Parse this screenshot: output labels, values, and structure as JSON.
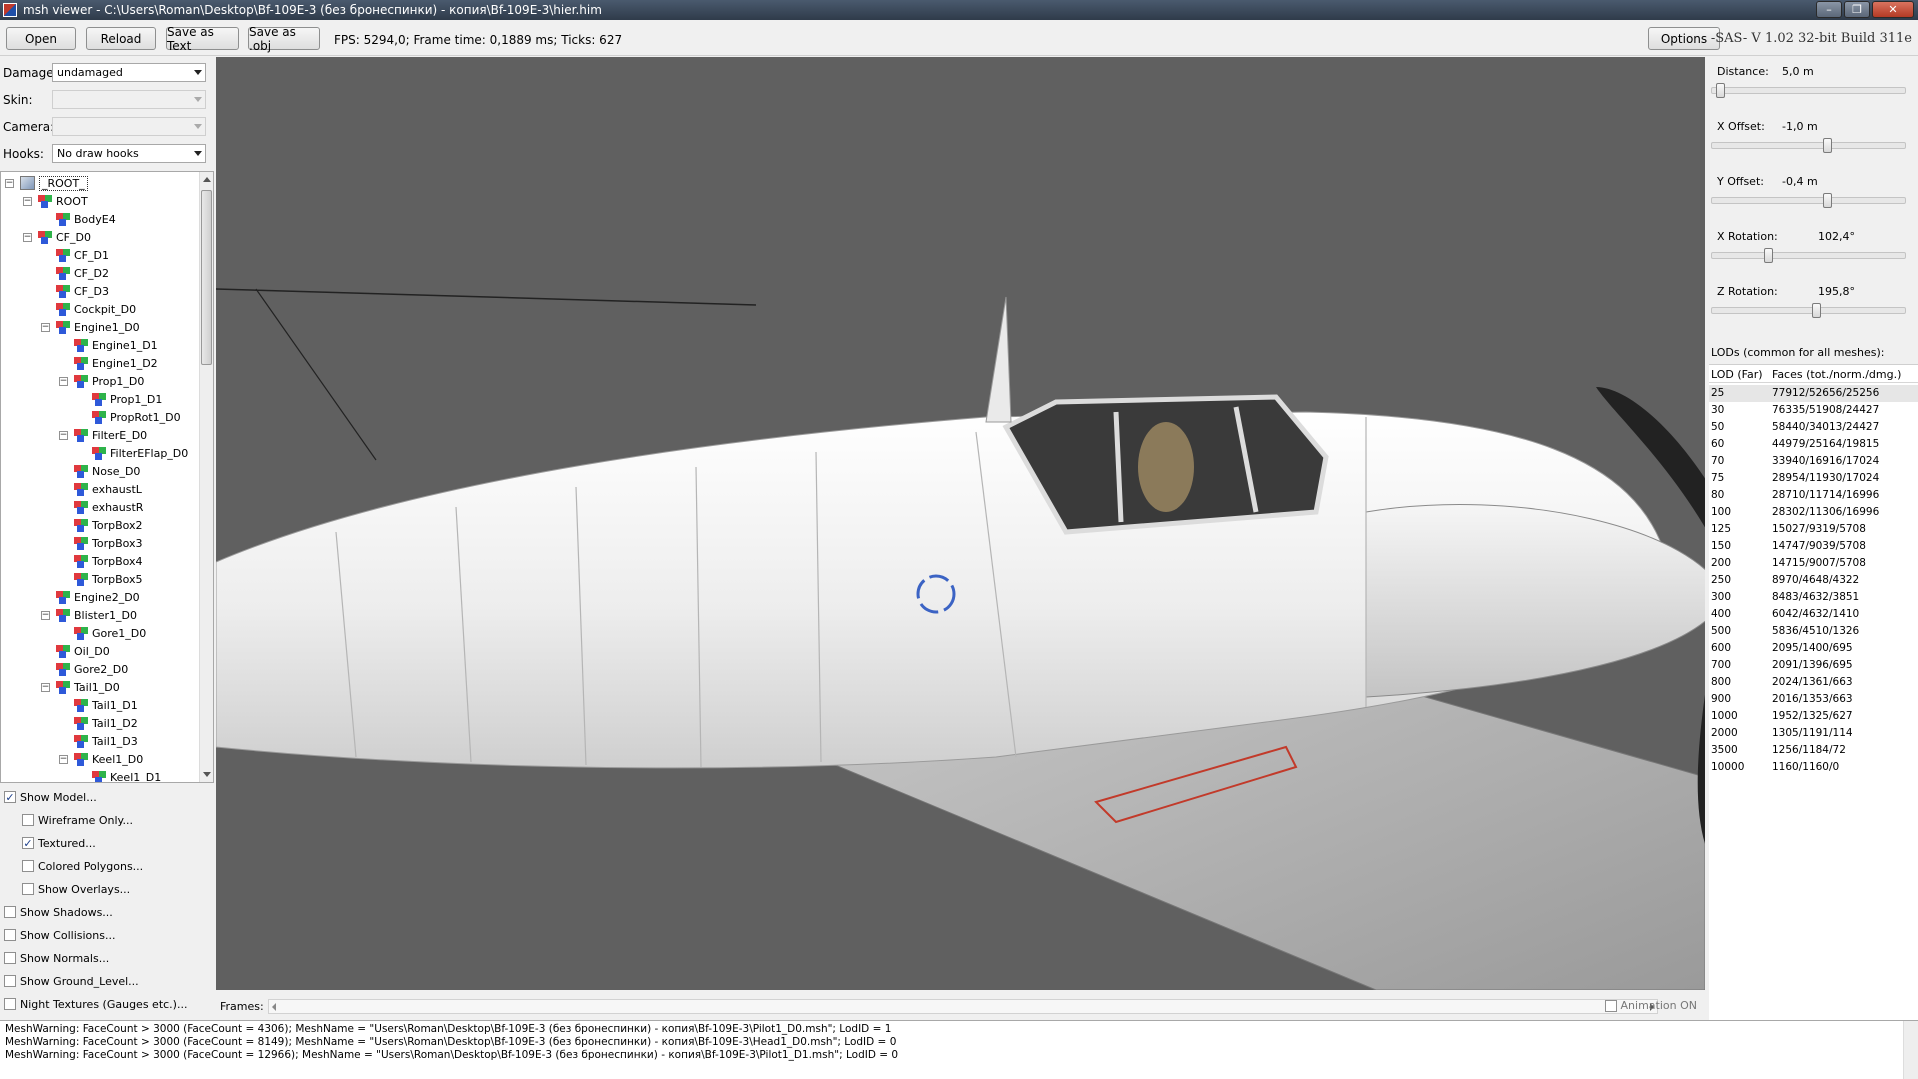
{
  "window": {
    "title": "msh viewer - C:\\Users\\Roman\\Desktop\\Bf-109E-3 (без бронеспинки) - копия\\Bf-109E-3\\hier.him",
    "minimize": "–",
    "maximize": "❐",
    "close": "✕"
  },
  "toolbar": {
    "open": "Open",
    "reload": "Reload",
    "save_text": "Save as Text",
    "save_obj": "Save as .obj",
    "status": "FPS: 5294,0; Frame time: 0,1889 ms; Ticks: 627",
    "options": "Options",
    "version": "-SAS- V 1.02  32-bit  Build 311e"
  },
  "filters": {
    "damage_label": "Damage:",
    "damage_value": "undamaged",
    "skin_label": "Skin:",
    "skin_value": "",
    "camera_label": "Camera:",
    "camera_value": "",
    "hooks_label": "Hooks:",
    "hooks_value": "No draw hooks"
  },
  "tree": {
    "root": "_ROOT_",
    "nodes": [
      {
        "label": "ROOT",
        "depth": 1,
        "expanded": true
      },
      {
        "label": "BodyE4",
        "depth": 2
      },
      {
        "label": "CF_D0",
        "depth": 1,
        "expanded": true
      },
      {
        "label": "CF_D1",
        "depth": 2
      },
      {
        "label": "CF_D2",
        "depth": 2
      },
      {
        "label": "CF_D3",
        "depth": 2
      },
      {
        "label": "Cockpit_D0",
        "depth": 2
      },
      {
        "label": "Engine1_D0",
        "depth": 2,
        "expanded": true
      },
      {
        "label": "Engine1_D1",
        "depth": 3
      },
      {
        "label": "Engine1_D2",
        "depth": 3
      },
      {
        "label": "Prop1_D0",
        "depth": 3,
        "expanded": true
      },
      {
        "label": "Prop1_D1",
        "depth": 4
      },
      {
        "label": "PropRot1_D0",
        "depth": 4
      },
      {
        "label": "FilterE_D0",
        "depth": 3,
        "expanded": true
      },
      {
        "label": "FilterEFlap_D0",
        "depth": 4
      },
      {
        "label": "Nose_D0",
        "depth": 3
      },
      {
        "label": "exhaustL",
        "depth": 3
      },
      {
        "label": "exhaustR",
        "depth": 3
      },
      {
        "label": "TorpBox2",
        "depth": 3
      },
      {
        "label": "TorpBox3",
        "depth": 3
      },
      {
        "label": "TorpBox4",
        "depth": 3
      },
      {
        "label": "TorpBox5",
        "depth": 3
      },
      {
        "label": "Engine2_D0",
        "depth": 2
      },
      {
        "label": "Blister1_D0",
        "depth": 2,
        "expanded": true
      },
      {
        "label": "Gore1_D0",
        "depth": 3
      },
      {
        "label": "Oil_D0",
        "depth": 2
      },
      {
        "label": "Gore2_D0",
        "depth": 2
      },
      {
        "label": "Tail1_D0",
        "depth": 2,
        "expanded": true
      },
      {
        "label": "Tail1_D1",
        "depth": 3
      },
      {
        "label": "Tail1_D2",
        "depth": 3
      },
      {
        "label": "Tail1_D3",
        "depth": 3
      },
      {
        "label": "Keel1_D0",
        "depth": 3,
        "expanded": true
      },
      {
        "label": "Keel1_D1",
        "depth": 4
      }
    ]
  },
  "options": [
    {
      "label": "Show Model...",
      "checked": true,
      "indent": 0
    },
    {
      "label": "Wireframe Only...",
      "checked": false,
      "indent": 1
    },
    {
      "label": "Textured...",
      "checked": true,
      "indent": 1
    },
    {
      "label": "Colored Polygons...",
      "checked": false,
      "indent": 1
    },
    {
      "label": "Show Overlays...",
      "checked": false,
      "indent": 1
    },
    {
      "label": "Show Shadows...",
      "checked": false,
      "indent": 0
    },
    {
      "label": "Show Collisions...",
      "checked": false,
      "indent": 0
    },
    {
      "label": "Show Normals...",
      "checked": false,
      "indent": 0
    },
    {
      "label": "Show Ground_Level...",
      "checked": false,
      "indent": 0
    },
    {
      "label": "Night Textures (Gauges etc.)...",
      "checked": false,
      "indent": 0
    }
  ],
  "frames": {
    "label": "Frames:",
    "animation_label": "Animation ON",
    "animation_on": false
  },
  "camera": {
    "distance_label": "Distance:",
    "distance": "5,0 m",
    "distance_level": 0.02,
    "xoffset_label": "X Offset:",
    "xoffset": "-1,0 m",
    "xoffset_level": 0.6,
    "yoffset_label": "Y Offset:",
    "yoffset": "-0,4 m",
    "yoffset_level": 0.6,
    "xrot_label": "X Rotation:",
    "xrot": "102,4°",
    "xrot_level": 0.28,
    "zrot_label": "Z Rotation:",
    "zrot": "195,8°",
    "zrot_level": 0.54
  },
  "lods": {
    "title": "LODs (common for all meshes):",
    "col_lod": "LOD (Far)",
    "col_faces": "Faces (tot./norm./dmg.)",
    "rows": [
      {
        "lod": "25",
        "faces": "77912/52656/25256"
      },
      {
        "lod": "30",
        "faces": "76335/51908/24427"
      },
      {
        "lod": "50",
        "faces": "58440/34013/24427"
      },
      {
        "lod": "60",
        "faces": "44979/25164/19815"
      },
      {
        "lod": "70",
        "faces": "33940/16916/17024"
      },
      {
        "lod": "75",
        "faces": "28954/11930/17024"
      },
      {
        "lod": "80",
        "faces": "28710/11714/16996"
      },
      {
        "lod": "100",
        "faces": "28302/11306/16996"
      },
      {
        "lod": "125",
        "faces": "15027/9319/5708"
      },
      {
        "lod": "150",
        "faces": "14747/9039/5708"
      },
      {
        "lod": "200",
        "faces": "14715/9007/5708"
      },
      {
        "lod": "250",
        "faces": "8970/4648/4322"
      },
      {
        "lod": "300",
        "faces": "8483/4632/3851"
      },
      {
        "lod": "400",
        "faces": "6042/4632/1410"
      },
      {
        "lod": "500",
        "faces": "5836/4510/1326"
      },
      {
        "lod": "600",
        "faces": "2095/1400/695"
      },
      {
        "lod": "700",
        "faces": "2091/1396/695"
      },
      {
        "lod": "800",
        "faces": "2024/1361/663"
      },
      {
        "lod": "900",
        "faces": "2016/1353/663"
      },
      {
        "lod": "1000",
        "faces": "1952/1325/627"
      },
      {
        "lod": "2000",
        "faces": "1305/1191/114"
      },
      {
        "lod": "3500",
        "faces": "1256/1184/72"
      },
      {
        "lod": "10000",
        "faces": "1160/1160/0"
      }
    ]
  },
  "log": [
    "MeshWarning: FaceCount > 3000 (FaceCount = 4306); MeshName = \"Users\\Roman\\Desktop\\Bf-109E-3 (без бронеспинки) - копия\\Bf-109E-3\\Pilot1_D0.msh\"; LodID = 1",
    "MeshWarning: FaceCount > 3000 (FaceCount = 8149); MeshName = \"Users\\Roman\\Desktop\\Bf-109E-3 (без бронеспинки) - копия\\Bf-109E-3\\Head1_D0.msh\"; LodID = 0",
    "MeshWarning: FaceCount > 3000 (FaceCount = 12966); MeshName = \"Users\\Roman\\Desktop\\Bf-109E-3 (без бронеспинки) - копия\\Bf-109E-3\\Pilot1_D1.msh\"; LodID = 0"
  ],
  "colors": {
    "viewport_bg": "#606060",
    "model": "#e9e9e9",
    "propeller": "#222222",
    "wing_marking": "#c23a2a"
  }
}
